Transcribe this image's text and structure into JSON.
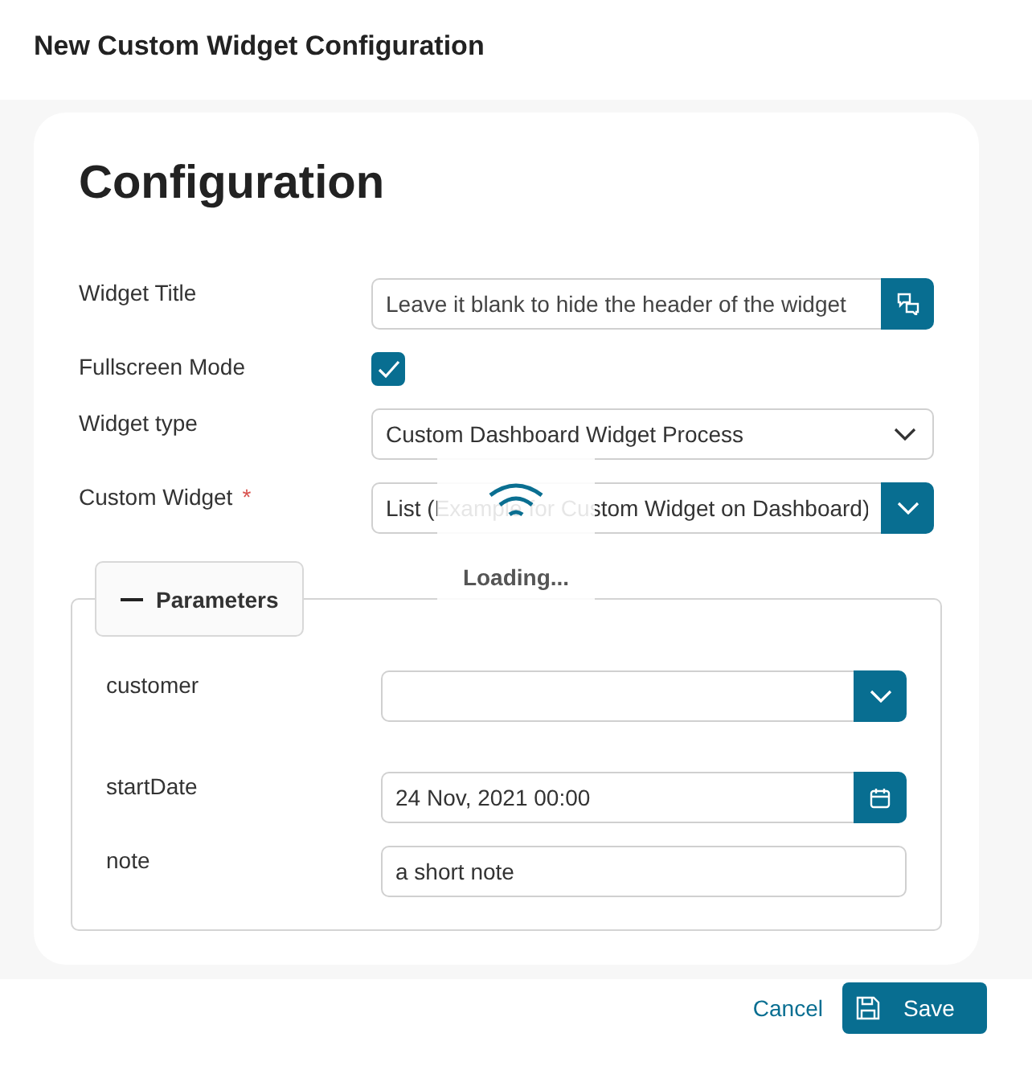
{
  "dialog": {
    "title": "New Custom Widget Configuration"
  },
  "card": {
    "heading": "Configuration"
  },
  "fields": [
    {
      "kind": "translatable_text",
      "label": "Widget Title",
      "placeholder": "Leave it blank to hide the header of the widget"
    },
    {
      "kind": "checkbox",
      "label": "Fullscreen Mode",
      "checked": true
    },
    {
      "kind": "select",
      "label": "Widget type",
      "value": "Custom Dashboard Widget Process"
    },
    {
      "kind": "combo",
      "label": "Custom Widget",
      "required_mark": "*",
      "value": "List (Example for Custom Widget on Dashboard)"
    }
  ],
  "loading": {
    "text": "Loading..."
  },
  "parameters": {
    "title": "Parameters",
    "expanded": true,
    "fields": [
      {
        "kind": "combo",
        "label": "customer"
      },
      {
        "kind": "date",
        "label": "startDate",
        "value": "24 Nov, 2021 00:00"
      },
      {
        "kind": "text",
        "label": "note",
        "value": "a short note"
      }
    ]
  },
  "footer": {
    "cancel": "Cancel",
    "save": "Save"
  }
}
